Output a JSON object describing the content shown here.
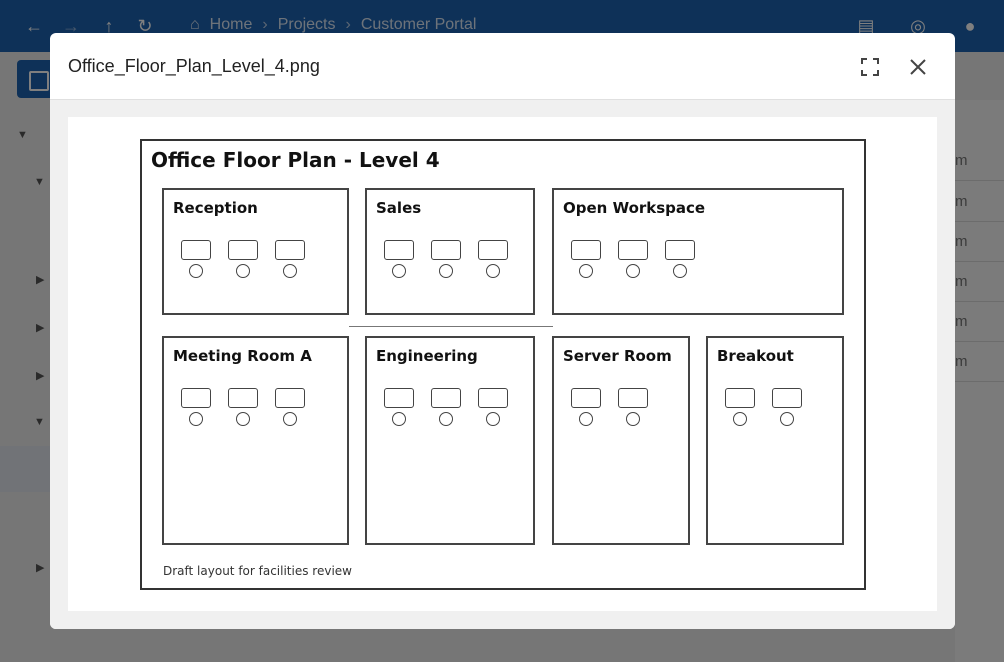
{
  "app": {
    "breadcrumbs": [
      "Home",
      "Projects",
      "Customer Portal"
    ],
    "right_column_cells": [
      "m",
      "m",
      "m",
      "m",
      "m",
      "m"
    ]
  },
  "modal": {
    "title": "Office_Floor_Plan_Level_4.png",
    "icons": {
      "expand": "expand-icon",
      "close": "close-icon"
    }
  },
  "floor_plan": {
    "title": "Office Floor Plan - Level 4",
    "note": "Draft layout for facilities review",
    "rooms": [
      {
        "name": "Reception",
        "desks": 3
      },
      {
        "name": "Sales",
        "desks": 3
      },
      {
        "name": "Open Workspace",
        "desks": 3
      },
      {
        "name": "Meeting Room A",
        "desks": 3
      },
      {
        "name": "Engineering",
        "desks": 3
      },
      {
        "name": "Server Room",
        "desks": 2
      },
      {
        "name": "Breakout",
        "desks": 2
      }
    ]
  },
  "colors": {
    "accent": "#1c62b0"
  }
}
